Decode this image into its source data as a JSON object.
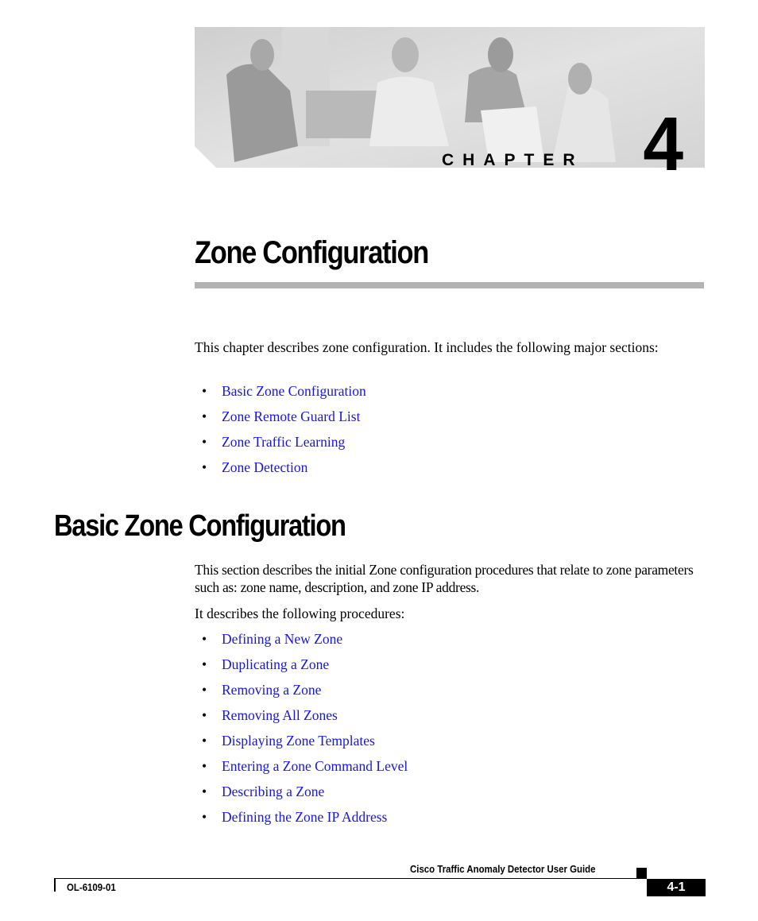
{
  "banner": {
    "image_description": "grayscale photo of four people working with network equipment and laptops",
    "chapter_label": "CHAPTER",
    "chapter_number": "4"
  },
  "chapter_title": "Zone Configuration",
  "intro": {
    "text": "This chapter describes zone configuration. It includes the following major sections:",
    "links": [
      "Basic Zone Configuration",
      "Zone Remote Guard List",
      "Zone Traffic Learning",
      "Zone Detection"
    ]
  },
  "section": {
    "title": "Basic Zone Configuration",
    "paragraph1": "This section describes the initial Zone configuration procedures that relate to zone parameters such as: zone name, description, and zone IP address.",
    "paragraph2": "It describes the following procedures:",
    "links": [
      "Defining a New Zone",
      "Duplicating a Zone",
      "Removing a Zone",
      "Removing All Zones",
      "Displaying Zone Templates",
      "Entering a Zone Command Level",
      "Describing a Zone",
      "Defining the Zone IP Address"
    ]
  },
  "bullet_glyph": "•",
  "footer": {
    "guide_title": "Cisco Traffic Anomaly Detector User Guide",
    "doc_number": "OL-6109-01",
    "page_number": "4-1"
  },
  "colors": {
    "link": "#1515ee",
    "rule": "#b3b3b3"
  }
}
